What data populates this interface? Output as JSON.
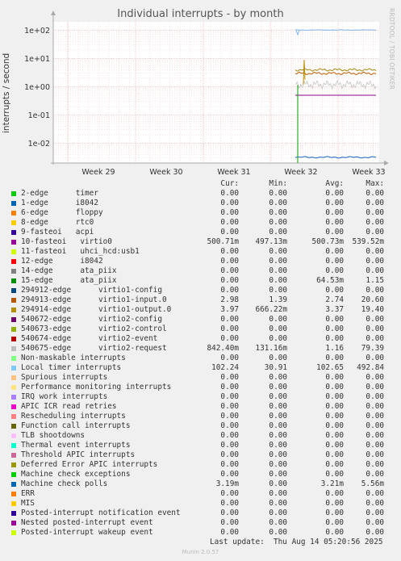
{
  "chart_data": {
    "type": "line",
    "title": "Individual interrupts - by month",
    "ylabel": "interrupts / second",
    "xlabel": "",
    "yscale": "log",
    "ylim": [
      0.002,
      200
    ],
    "y_ticks": [
      "1e+02",
      "1e+01",
      "1e+00",
      "1e-01",
      "1e-02"
    ],
    "x_ticks": [
      "Week 29",
      "Week 30",
      "Week 31",
      "Week 32",
      "Week 33"
    ],
    "grid": true,
    "series_summary": [
      {
        "name": "Local timer interrupts",
        "color": "#7cb5ec",
        "level": 102.24
      },
      {
        "name": "294914-edge virtio1-output.0",
        "color": "#a8860b",
        "level": 3.97
      },
      {
        "name": "294913-edge virtio1-input.0",
        "color": "#c05a00",
        "level": 2.98
      },
      {
        "name": "540675-edge virtio2-request",
        "color": "#bbbbbb",
        "level": 1.2
      },
      {
        "name": "10-fasteoi virtio0",
        "color": "#880088",
        "level": 0.50071
      },
      {
        "name": "Machine check polls",
        "color": "#1565c0",
        "level": 0.00319
      },
      {
        "name": "15-edge ata_piix",
        "color": "#00a000",
        "level": 0.0
      }
    ]
  },
  "side_label": "RRDTOOL / TOBI OETIKER",
  "table": {
    "headers": [
      "Cur:",
      "Min:",
      "Avg:",
      "Max:"
    ],
    "rows": [
      {
        "label": "2-edge      timer",
        "color": "#00cc00",
        "cur": "0.00",
        "min": "0.00",
        "avg": "0.00",
        "max": "0.00"
      },
      {
        "label": "1-edge      i8042",
        "color": "#0066b3",
        "cur": "0.00",
        "min": "0.00",
        "avg": "0.00",
        "max": "0.00"
      },
      {
        "label": "6-edge      floppy",
        "color": "#ff8000",
        "cur": "0.00",
        "min": "0.00",
        "avg": "0.00",
        "max": "0.00"
      },
      {
        "label": "8-edge      rtc0",
        "color": "#ffcc00",
        "cur": "0.00",
        "min": "0.00",
        "avg": "0.00",
        "max": "0.00"
      },
      {
        "label": "9-fasteoi   acpi",
        "color": "#330099",
        "cur": "0.00",
        "min": "0.00",
        "avg": "0.00",
        "max": "0.00"
      },
      {
        "label": "10-fasteoi   virtio0",
        "color": "#990099",
        "cur": "500.71m",
        "min": "497.13m",
        "avg": "500.73m",
        "max": "539.52m"
      },
      {
        "label": "11-fasteoi   uhci_hcd:usb1",
        "color": "#ccff00",
        "cur": "0.00",
        "min": "0.00",
        "avg": "0.00",
        "max": "0.00"
      },
      {
        "label": "12-edge      i8042",
        "color": "#ff0000",
        "cur": "0.00",
        "min": "0.00",
        "avg": "0.00",
        "max": "0.00"
      },
      {
        "label": "14-edge      ata_piix",
        "color": "#808080",
        "cur": "0.00",
        "min": "0.00",
        "avg": "0.00",
        "max": "0.00"
      },
      {
        "label": "15-edge      ata_piix",
        "color": "#008f00",
        "cur": "0.00",
        "min": "0.00",
        "avg": "64.53m",
        "max": "1.15"
      },
      {
        "label": "294912-edge      virtio1-config",
        "color": "#00487d",
        "cur": "0.00",
        "min": "0.00",
        "avg": "0.00",
        "max": "0.00"
      },
      {
        "label": "294913-edge      virtio1-input.0",
        "color": "#b35a00",
        "cur": "2.98",
        "min": "1.39",
        "avg": "2.74",
        "max": "20.60"
      },
      {
        "label": "294914-edge      virtio1-output.0",
        "color": "#b38f00",
        "cur": "3.97",
        "min": "666.22m",
        "avg": "3.37",
        "max": "19.40"
      },
      {
        "label": "540672-edge      virtio2-config",
        "color": "#6b006b",
        "cur": "0.00",
        "min": "0.00",
        "avg": "0.00",
        "max": "0.00"
      },
      {
        "label": "540673-edge      virtio2-control",
        "color": "#8fb300",
        "cur": "0.00",
        "min": "0.00",
        "avg": "0.00",
        "max": "0.00"
      },
      {
        "label": "540674-edge      virtio2-event",
        "color": "#b30000",
        "cur": "0.00",
        "min": "0.00",
        "avg": "0.00",
        "max": "0.00"
      },
      {
        "label": "540675-edge      virtio2-request",
        "color": "#bebebe",
        "cur": "842.40m",
        "min": "131.16m",
        "avg": "1.16",
        "max": "79.39"
      },
      {
        "label": "Non-maskable interrupts",
        "color": "#80ff80",
        "cur": "0.00",
        "min": "0.00",
        "avg": "0.00",
        "max": "0.00"
      },
      {
        "label": "Local timer interrupts",
        "color": "#80c9ff",
        "cur": "102.24",
        "min": "30.91",
        "avg": "102.65",
        "max": "492.84"
      },
      {
        "label": "Spurious interrupts",
        "color": "#ffc080",
        "cur": "0.00",
        "min": "0.00",
        "avg": "0.00",
        "max": "0.00"
      },
      {
        "label": "Performance monitoring interrupts",
        "color": "#ffe680",
        "cur": "0.00",
        "min": "0.00",
        "avg": "0.00",
        "max": "0.00"
      },
      {
        "label": "IRQ work interrupts",
        "color": "#aa80ff",
        "cur": "0.00",
        "min": "0.00",
        "avg": "0.00",
        "max": "0.00"
      },
      {
        "label": "APIC ICR read retries",
        "color": "#ee00cc",
        "cur": "0.00",
        "min": "0.00",
        "avg": "0.00",
        "max": "0.00"
      },
      {
        "label": "Rescheduling interrupts",
        "color": "#ff8080",
        "cur": "0.00",
        "min": "0.00",
        "avg": "0.00",
        "max": "0.00"
      },
      {
        "label": "Function call interrupts",
        "color": "#666600",
        "cur": "0.00",
        "min": "0.00",
        "avg": "0.00",
        "max": "0.00"
      },
      {
        "label": "TLB shootdowns",
        "color": "#ffbfff",
        "cur": "0.00",
        "min": "0.00",
        "avg": "0.00",
        "max": "0.00"
      },
      {
        "label": "Thermal event interrupts",
        "color": "#00ffcc",
        "cur": "0.00",
        "min": "0.00",
        "avg": "0.00",
        "max": "0.00"
      },
      {
        "label": "Threshold APIC interrupts",
        "color": "#cc6699",
        "cur": "0.00",
        "min": "0.00",
        "avg": "0.00",
        "max": "0.00"
      },
      {
        "label": "Deferred Error APIC interrupts",
        "color": "#999900",
        "cur": "0.00",
        "min": "0.00",
        "avg": "0.00",
        "max": "0.00"
      },
      {
        "label": "Machine check exceptions",
        "color": "#00cc00",
        "cur": "0.00",
        "min": "0.00",
        "avg": "0.00",
        "max": "0.00"
      },
      {
        "label": "Machine check polls",
        "color": "#0066b3",
        "cur": "3.19m",
        "min": "0.00",
        "avg": "3.21m",
        "max": "5.56m"
      },
      {
        "label": "ERR",
        "color": "#ff8000",
        "cur": "0.00",
        "min": "0.00",
        "avg": "0.00",
        "max": "0.00"
      },
      {
        "label": "MIS",
        "color": "#ffcc00",
        "cur": "0.00",
        "min": "0.00",
        "avg": "0.00",
        "max": "0.00"
      },
      {
        "label": "Posted-interrupt notification event",
        "color": "#330099",
        "cur": "0.00",
        "min": "0.00",
        "avg": "0.00",
        "max": "0.00"
      },
      {
        "label": "Nested posted-interrupt event",
        "color": "#990099",
        "cur": "0.00",
        "min": "0.00",
        "avg": "0.00",
        "max": "0.00"
      },
      {
        "label": "Posted-interrupt wakeup event",
        "color": "#ccff00",
        "cur": "0.00",
        "min": "0.00",
        "avg": "0.00",
        "max": "0.00"
      }
    ]
  },
  "footer": {
    "last_update": "Last update:  Thu Aug 14 05:20:56 2025",
    "munin": "Munin 2.0.57"
  }
}
